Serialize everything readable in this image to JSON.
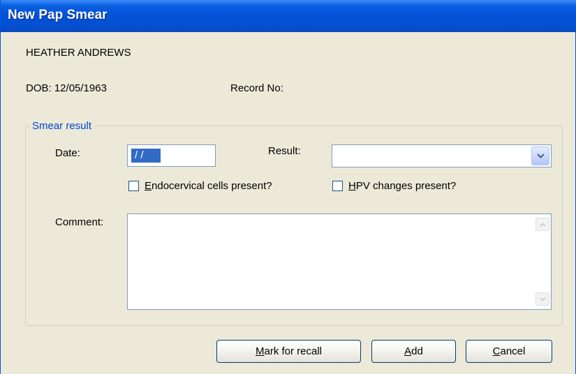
{
  "window": {
    "title": "New Pap Smear"
  },
  "patient": {
    "name": "HEATHER ANDREWS",
    "dob": "DOB: 12/05/1963",
    "record_label": "Record No:"
  },
  "smear_result": {
    "legend": "Smear result",
    "date_label": "Date:",
    "date_value": "/ /",
    "result_label": "Result:",
    "result_value": "",
    "endocervical": {
      "mnemonic": "E",
      "rest": "ndocervical cells present?",
      "checked": false
    },
    "hpv": {
      "mnemonic": "H",
      "rest": "PV changes present?",
      "checked": false
    },
    "comment_label": "Comment:",
    "comment_value": ""
  },
  "buttons": {
    "mark_recall": {
      "mnemonic": "M",
      "rest": "ark for recall"
    },
    "add": {
      "mnemonic": "A",
      "rest": "dd"
    },
    "cancel": {
      "mnemonic": "C",
      "rest": "ancel"
    }
  },
  "icons": [
    "chevron-down-icon",
    "scroll-up-icon",
    "scroll-down-icon"
  ],
  "colors": {
    "titlebar": "#0351D6",
    "dialog_bg": "#ECE9D8",
    "group_label": "#0046D5",
    "selection": "#316AC5"
  }
}
